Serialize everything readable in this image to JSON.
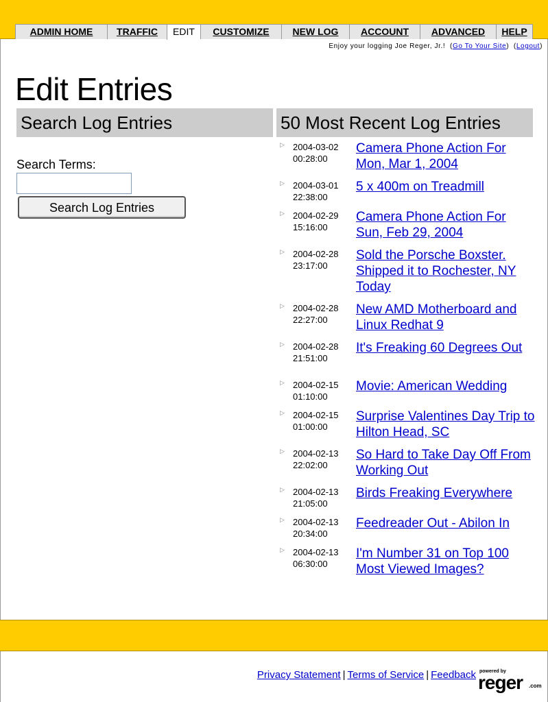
{
  "nav": {
    "tabs": [
      {
        "label": "ADMIN HOME",
        "active": false
      },
      {
        "label": "TRAFFIC",
        "active": false
      },
      {
        "label": "EDIT",
        "active": true
      },
      {
        "label": "CUSTOMIZE",
        "active": false
      },
      {
        "label": "NEW LOG",
        "active": false
      },
      {
        "label": "ACCOUNT",
        "active": false
      },
      {
        "label": "ADVANCED",
        "active": false
      },
      {
        "label": "HELP",
        "active": false
      }
    ]
  },
  "greeting": {
    "text": "Enjoy your logging Joe Reger, Jr.!",
    "site_link": "Go To Your Site",
    "logout_link": "Logout"
  },
  "page_title": "Edit Entries",
  "search": {
    "header": "Search Log Entries",
    "label": "Search Terms:",
    "value": "",
    "button": "Search Log Entries"
  },
  "recent": {
    "header": "50 Most Recent Log Entries",
    "entries": [
      {
        "date": "2004-03-02",
        "time": "00:28:00",
        "title": "Camera Phone Action For Mon, Mar 1, 2004"
      },
      {
        "date": "2004-03-01",
        "time": "22:38:00",
        "title": "5 x 400m on Treadmill"
      },
      {
        "date": "2004-02-29",
        "time": "15:16:00",
        "title": "Camera Phone Action For Sun, Feb 29, 2004"
      },
      {
        "date": "2004-02-28",
        "time": "23:17:00",
        "title": "Sold the Porsche Boxster. Shipped it to Rochester, NY Today"
      },
      {
        "date": "2004-02-28",
        "time": "22:27:00",
        "title": "New AMD Motherboard and Linux Redhat 9"
      },
      {
        "date": "2004-02-28",
        "time": "21:51:00",
        "title": "It's Freaking 60 Degrees Out"
      },
      {
        "date": "2004-02-15",
        "time": "01:10:00",
        "title": "Movie: American Wedding"
      },
      {
        "date": "2004-02-15",
        "time": "01:00:00",
        "title": "Surprise Valentines Day Trip to Hilton Head, SC"
      },
      {
        "date": "2004-02-13",
        "time": "22:02:00",
        "title": "So Hard to Take Day Off From Working Out"
      },
      {
        "date": "2004-02-13",
        "time": "21:05:00",
        "title": "Birds Freaking Everywhere"
      },
      {
        "date": "2004-02-13",
        "time": "20:34:00",
        "title": "Feedreader Out - Abilon In"
      },
      {
        "date": "2004-02-13",
        "time": "06:30:00",
        "title": "I'm Number 31 on Top 100 Most Viewed Images?"
      }
    ]
  },
  "footer": {
    "privacy": "Privacy Statement",
    "terms": "Terms of Service",
    "feedback": "Feedback",
    "sep": "|"
  },
  "logo": {
    "powered_by": "powered by",
    "name": "reger",
    "suffix": ".com"
  },
  "colors": {
    "brand_yellow": "#ffcc00",
    "panel_gray": "#cccccc",
    "link_blue": "#0000cc"
  },
  "icons": {
    "entry_arrow": "triangle-right-icon"
  }
}
